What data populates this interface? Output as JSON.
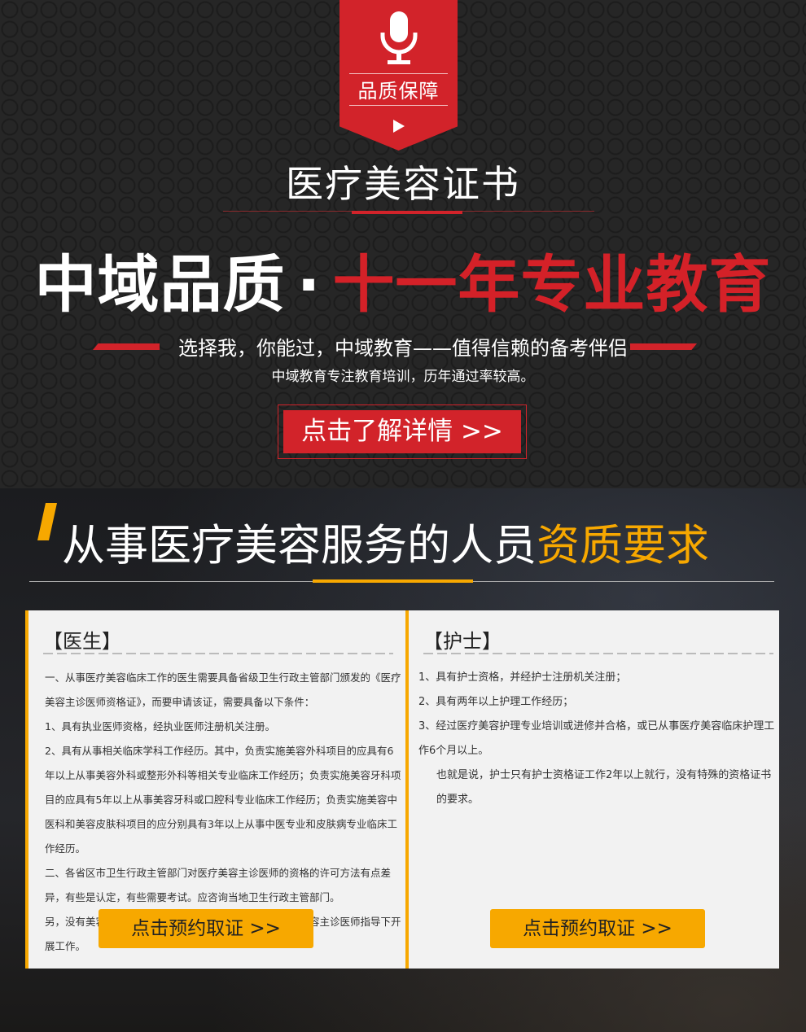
{
  "banner": {
    "badge_label": "品质保障",
    "badge_icon": "microphone-icon",
    "play_icon": "play-icon",
    "cert_title": "医疗美容证书",
    "headline_left": "中域品质",
    "headline_dot": "·",
    "headline_right": "十一年专业教育",
    "tagline": "选择我，你能过，中域教育——值得信赖的备考伴侣",
    "subtagline": "中域教育专注教育培训，历年通过率较高。",
    "details_button": "点击了解详情 >>"
  },
  "requirements": {
    "title_main": "从事医疗美容服务的人员",
    "title_highlight": "资质要求"
  },
  "doctor": {
    "heading": "【医生】",
    "paragraphs": [
      "一、从事医疗美容临床工作的医生需要具备省级卫生行政主管部门颁发的《医疗美容主诊医师资格证》，而要申请该证，需要具备以下条件：",
      "1、具有执业医师资格，经执业医师注册机关注册。",
      "2、具有从事相关临床学科工作经历。其中，负责实施美容外科项目的应具有6年以上从事美容外科或整形外科等相关专业临床工作经历；负责实施美容牙科项目的应具有5年以上从事美容牙科或口腔科专业临床工作经历；负责实施美容中医科和美容皮肤科项目的应分别具有3年以上从事中医专业和皮肤病专业临床工作经历。",
      "二、各省区市卫生行政主管部门对医疗美容主诊医师的资格的许可方法有点差异，有些是认定，有些需要考试。应咨询当地卫生行政主管部门。",
      "另，没有美容医师主诊医师资格证书的执业医师，可以在美容主诊医师指导下开展工作。"
    ],
    "button": "点击预约取证 >>"
  },
  "nurse": {
    "heading": "【护士】",
    "paragraphs": [
      "1、具有护士资格，并经护士注册机关注册；",
      "2、具有两年以上护理工作经历；",
      "3、经过医疗美容护理专业培训或进修并合格，或已从事医疗美容临床护理工作6个月以上。",
      "也就是说，护士只有护士资格证工作2年以上就行，没有特殊的资格证书的要求。"
    ],
    "button": "点击预约取证 >>"
  },
  "colors": {
    "red": "#d2232a",
    "orange": "#f7a800",
    "dark": "#262626"
  }
}
